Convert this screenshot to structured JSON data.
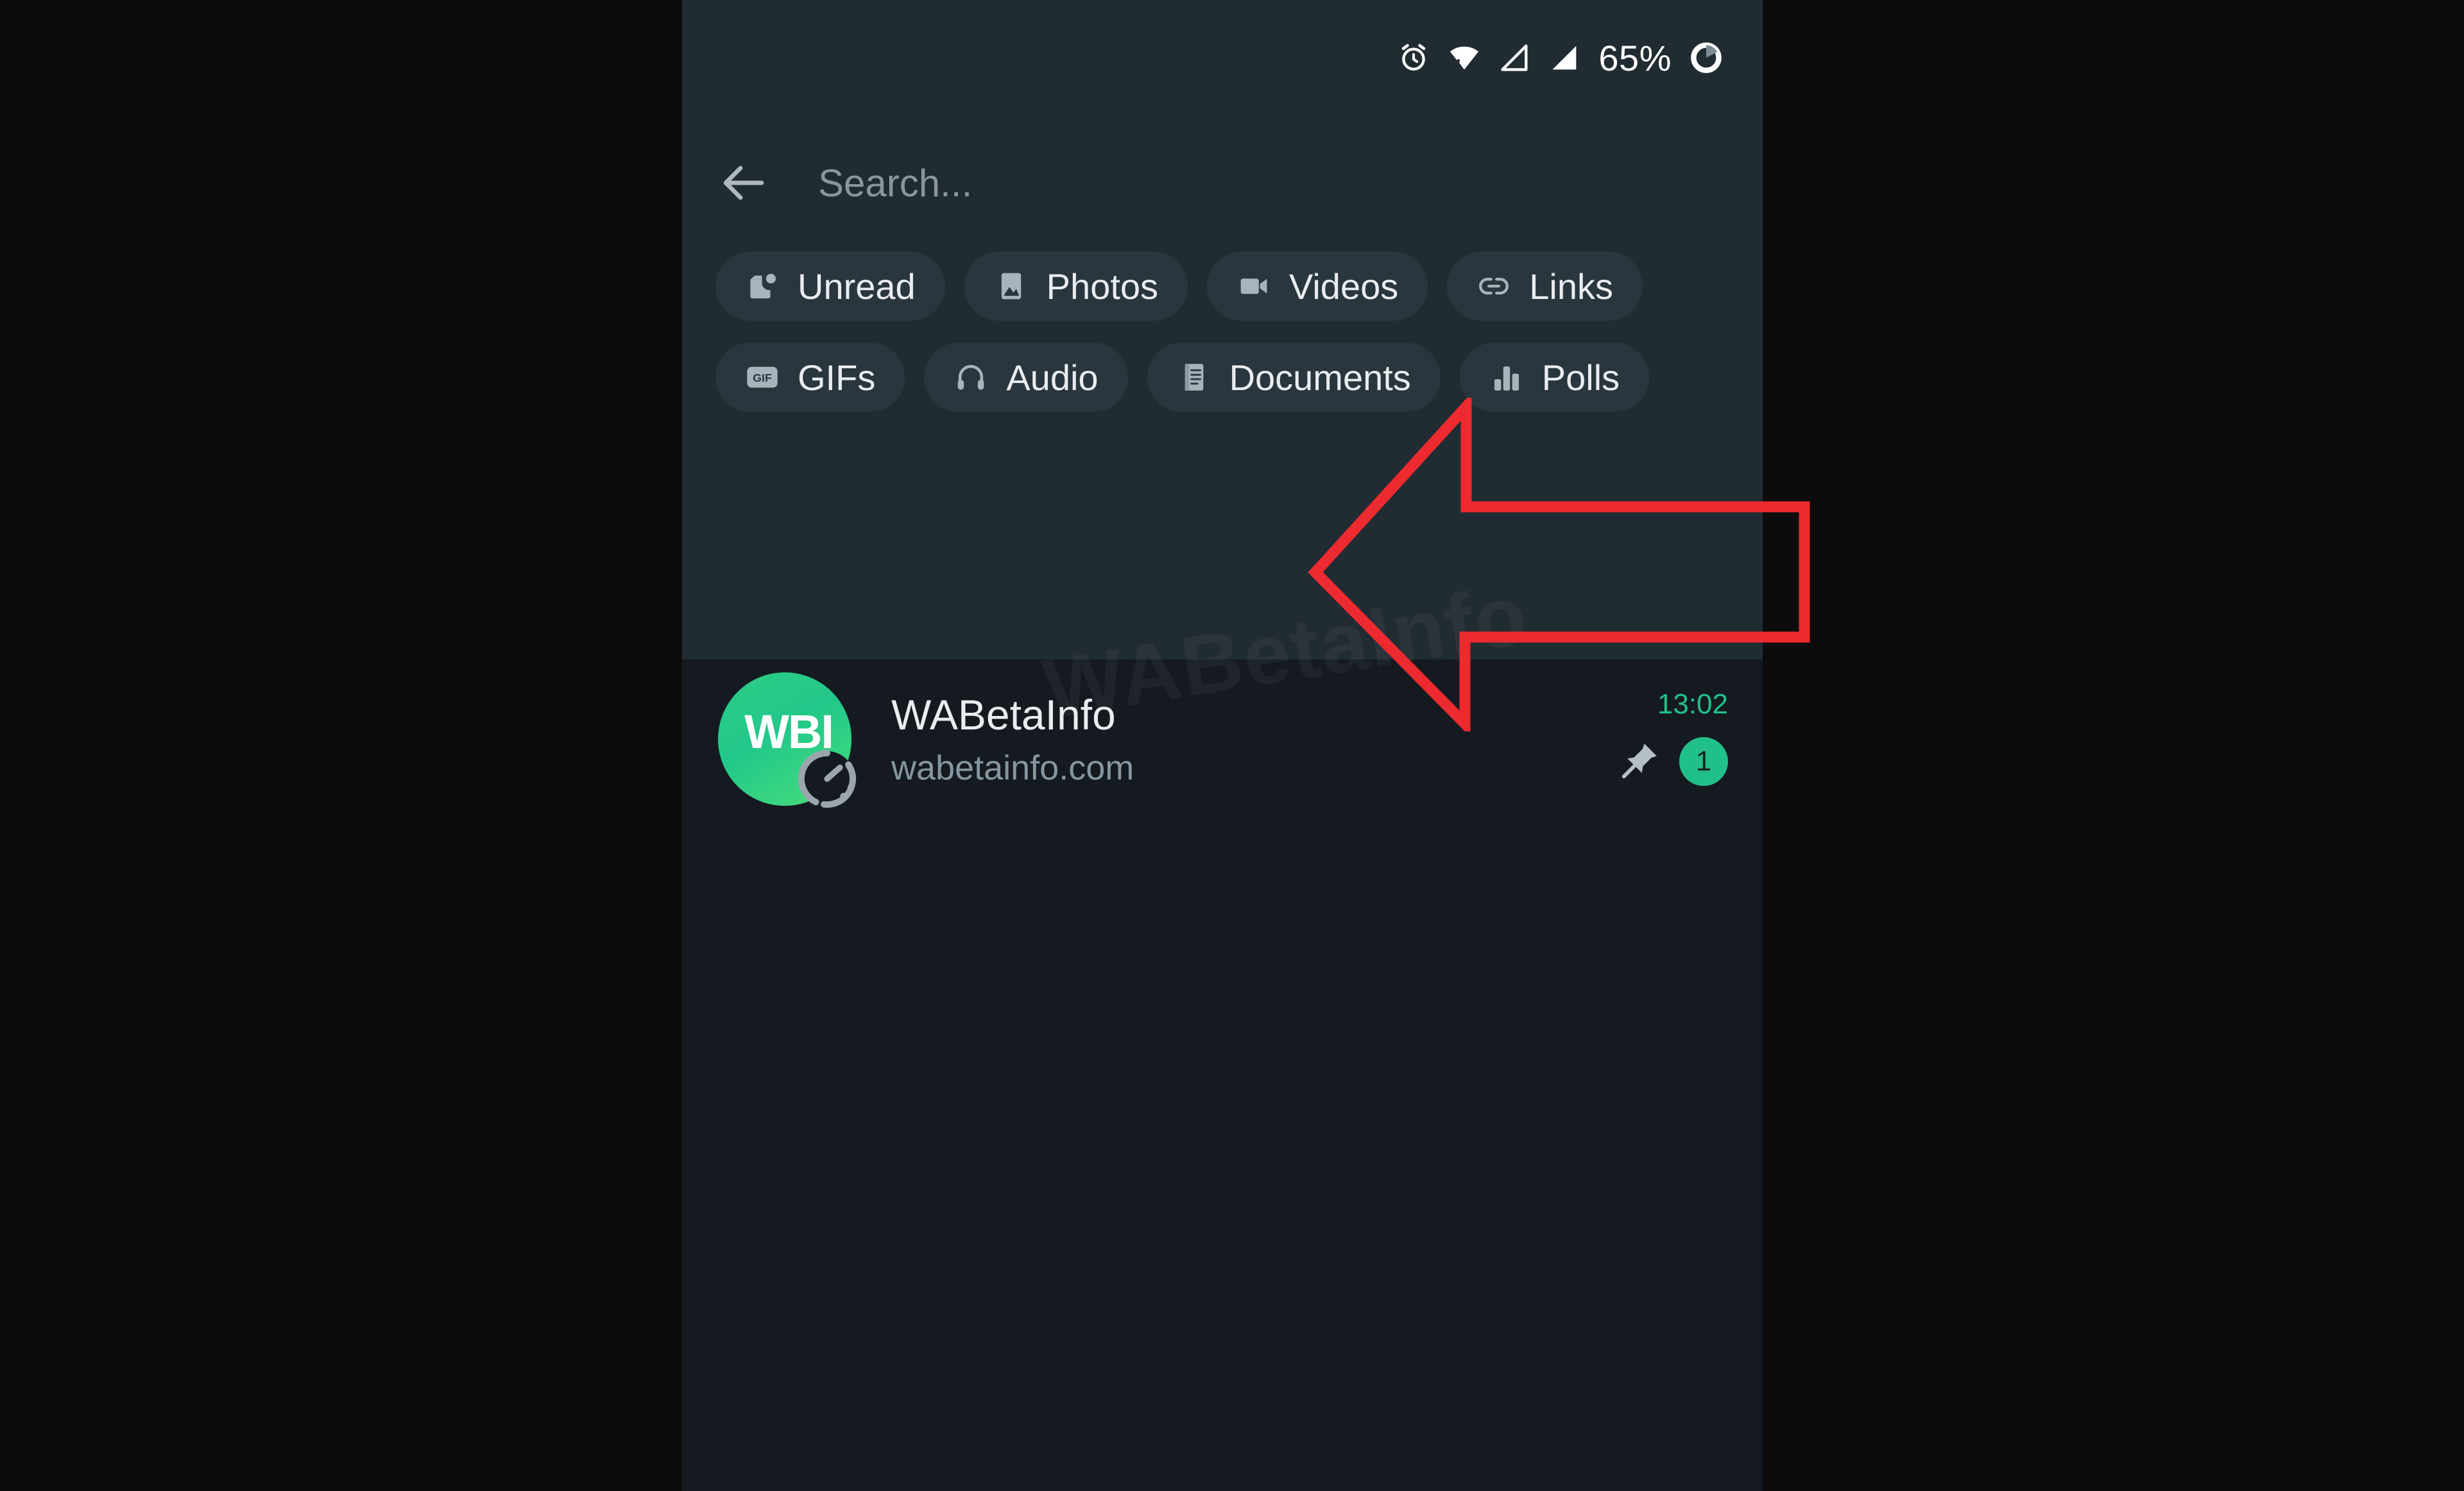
{
  "status_bar": {
    "battery_percent": "65%",
    "icons": [
      "alarm-icon",
      "wifi-icon",
      "signal-sim1-icon",
      "signal-sim2-icon",
      "battery-circle-icon"
    ]
  },
  "search": {
    "back_icon": "back-arrow-icon",
    "placeholder": "Search...",
    "value": ""
  },
  "filters": {
    "chips": [
      {
        "label": "Unread",
        "icon": "mark-unread-icon"
      },
      {
        "label": "Photos",
        "icon": "photo-icon"
      },
      {
        "label": "Videos",
        "icon": "video-camera-icon"
      },
      {
        "label": "Links",
        "icon": "link-icon"
      },
      {
        "label": "GIFs",
        "icon": "gif-badge-icon"
      },
      {
        "label": "Audio",
        "icon": "headphones-icon"
      },
      {
        "label": "Documents",
        "icon": "document-icon"
      },
      {
        "label": "Polls",
        "icon": "poll-bars-icon"
      }
    ]
  },
  "watermark": {
    "text": "WABetaInfo"
  },
  "chat_list": {
    "rows": [
      {
        "avatar_initials": "WBI",
        "avatar_badge_icon": "disappearing-messages-timer-icon",
        "title": "WABetaInfo",
        "subtitle": "wabetainfo.com",
        "time": "13:02",
        "pin_icon": "pin-icon",
        "unread_count": "1"
      }
    ]
  },
  "annotation": {
    "type": "left-pointing-arrow",
    "color": "#ed2a2f",
    "points_at": "Polls"
  },
  "colors": {
    "page_background": "#0c0c0d",
    "screen_background": "#151a21",
    "header_background": "#212b32",
    "chip_background": "#2a363d",
    "accent_green": "#21c08a",
    "primary_text": "#e9edef",
    "secondary_text": "#8696a0",
    "annotation_red": "#ed2a2f"
  }
}
